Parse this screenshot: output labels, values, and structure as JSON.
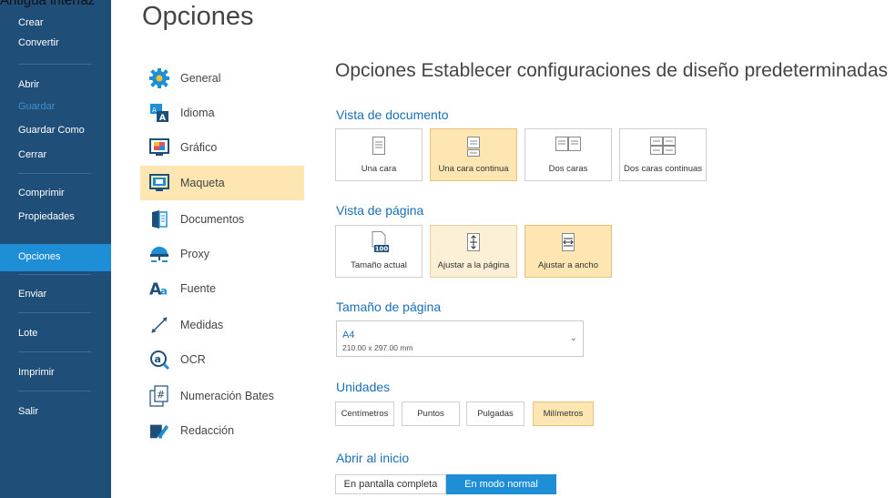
{
  "caption": "Antigua interfaz",
  "sidebar": {
    "items": [
      {
        "label": "Crear"
      },
      {
        "label": "Convertir"
      },
      {
        "label": "Abrir"
      },
      {
        "label": "Guardar"
      },
      {
        "label": "Guardar Como"
      },
      {
        "label": "Cerrar"
      },
      {
        "label": "Comprimir"
      },
      {
        "label": "Propiedades"
      },
      {
        "label": "Opciones"
      },
      {
        "label": "Enviar"
      },
      {
        "label": "Lote"
      },
      {
        "label": "Imprimir"
      },
      {
        "label": "Salir"
      }
    ]
  },
  "page_title": "Opciones",
  "categories": [
    {
      "label": "General",
      "icon": "gear-icon"
    },
    {
      "label": "Idioma",
      "icon": "language-icon"
    },
    {
      "label": "Gráfico",
      "icon": "graphic-icon"
    },
    {
      "label": "Maqueta",
      "icon": "layout-icon"
    },
    {
      "label": "Documentos",
      "icon": "documents-icon"
    },
    {
      "label": "Proxy",
      "icon": "proxy-icon"
    },
    {
      "label": "Fuente",
      "icon": "font-icon"
    },
    {
      "label": "Medidas",
      "icon": "measure-icon"
    },
    {
      "label": "OCR",
      "icon": "ocr-icon"
    },
    {
      "label": "Numeración Bates",
      "icon": "bates-icon"
    },
    {
      "label": "Redacción",
      "icon": "redaction-icon"
    }
  ],
  "panel": {
    "title": "Opciones Establecer configuraciones de diseño predeterminadas",
    "document_view": {
      "heading": "Vista de documento",
      "options": [
        {
          "label": "Una cara"
        },
        {
          "label": "Una cara continua"
        },
        {
          "label": "Dos caras"
        },
        {
          "label": "Dos caras continuas"
        }
      ],
      "selected": "Una cara continua"
    },
    "page_view": {
      "heading": "Vista de página",
      "options": [
        {
          "label": "Tamaño actual",
          "badge": "100"
        },
        {
          "label": "Ajustar a la página"
        },
        {
          "label": "Ajustar a ancho"
        }
      ],
      "selected": "Ajustar a ancho"
    },
    "page_size": {
      "heading": "Tamaño de página",
      "value": "A4",
      "sub": "210.00 x 297.00 mm"
    },
    "units": {
      "heading": "Unidades",
      "options": [
        "Centímetros",
        "Puntos",
        "Pulgadas",
        "Milímetros"
      ],
      "selected": "Milímetros"
    },
    "startup": {
      "heading": "Abrir al inicio",
      "options": [
        "En pantalla completa",
        "En modo normal"
      ],
      "selected": "En modo normal"
    }
  },
  "colors": {
    "sidebar": "#1f4e79",
    "accent": "#1e8fd6",
    "selected": "#fde6b2",
    "heading": "#1c6fb8"
  }
}
